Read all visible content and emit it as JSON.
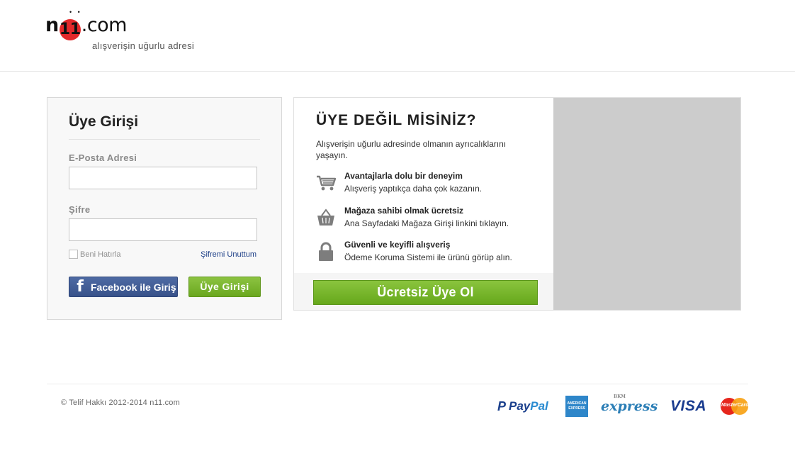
{
  "header": {
    "logo_prefix": "n",
    "logo_ones": "11",
    "logo_suffix": ".com",
    "logo_tagline": "alışverişin uğurlu adresi"
  },
  "login": {
    "title": "Üye Girişi",
    "email_label": "E-Posta Adresi",
    "email_value": "",
    "password_label": "Şifre",
    "password_value": "",
    "remember_label": "Beni Hatırla",
    "forgot_label": "Şifremi Unuttum",
    "facebook_label": "Facebook ile Giriş",
    "submit_label": "Üye Girişi"
  },
  "register": {
    "title": "ÜYE DEĞİL MİSİNİZ?",
    "description": "Alışverişin uğurlu adresinde olmanın ayrıcalıklarını yaşayın.",
    "benefits": [
      {
        "icon": "cart-icon",
        "title": "Avantajlarla dolu bir deneyim",
        "text": "Alışveriş yaptıkça daha çok kazanın."
      },
      {
        "icon": "basket-icon",
        "title": "Mağaza sahibi olmak ücretsiz",
        "text": "Ana Sayfadaki Mağaza Girişi linkini tıklayın."
      },
      {
        "icon": "lock-icon",
        "title": "Güvenli ve keyifli alışveriş",
        "text": "Ödeme Koruma Sistemi ile ürünü görüp alın."
      }
    ],
    "button_label": "Ücretsiz Üye Ol"
  },
  "footer": {
    "copyright": "© Telif Hakkı 2012-2014 n11.com",
    "payments": {
      "paypal_pay": "Pay",
      "paypal_pal": "Pal",
      "amex": "AMERICAN EXPRESS",
      "bkm_small": "BKM",
      "bkm_express": "express",
      "visa": "VISA",
      "mastercard": "MasterCard"
    }
  },
  "colors": {
    "brand_red": "#e3292b",
    "green_button": "#78b42b",
    "facebook_blue": "#3f5a94",
    "link_blue": "#1d3f87",
    "promo_gray": "#cccccc"
  }
}
